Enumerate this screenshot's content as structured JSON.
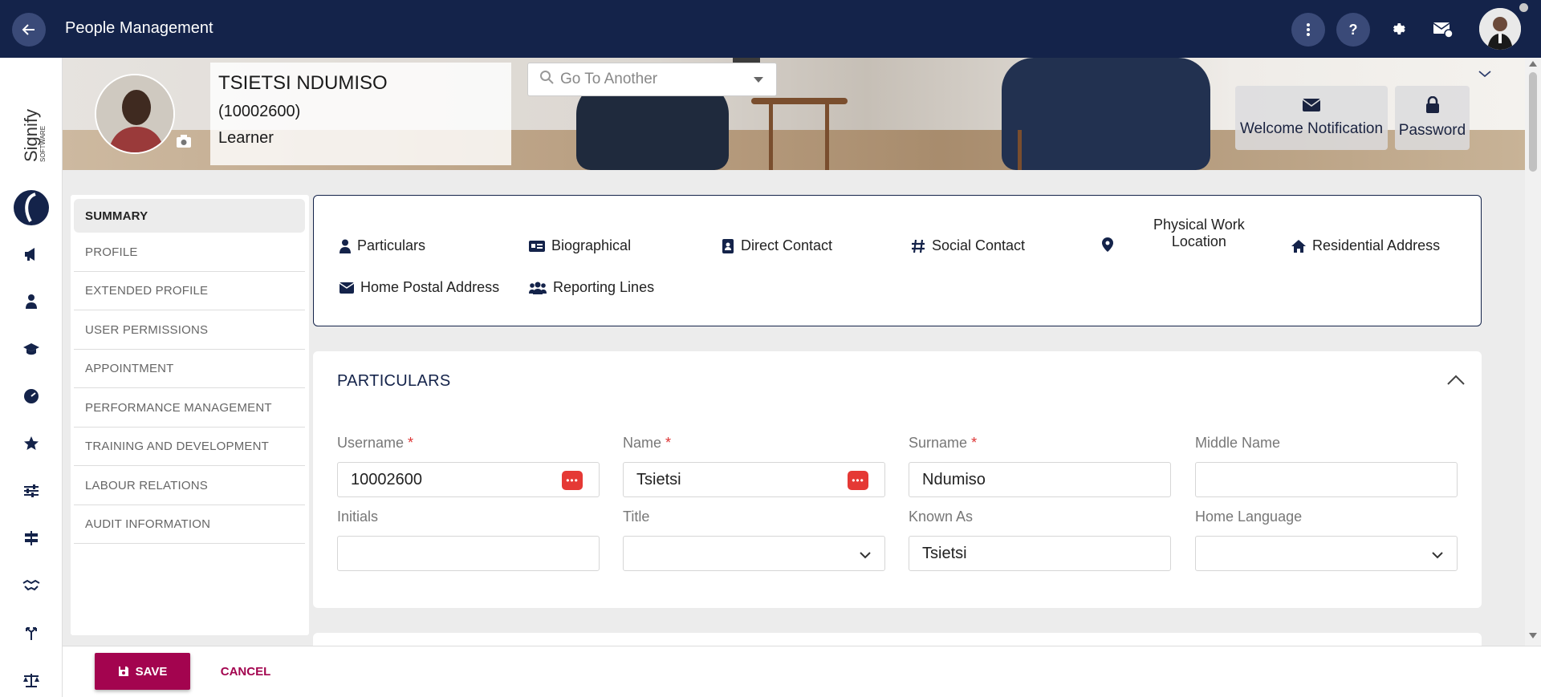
{
  "app": {
    "title": "People Management"
  },
  "profile": {
    "name": "TSIETSI NDUMISO",
    "id": "(10002600)",
    "role": "Learner"
  },
  "goto": {
    "placeholder": "Go To Another"
  },
  "banner_buttons": {
    "welcome": "Welcome Notification",
    "password": "Password"
  },
  "logo": {
    "brand": "Signify",
    "sub": "SOFTWARE"
  },
  "sidenav": {
    "items": [
      "SUMMARY",
      "PROFILE",
      "EXTENDED PROFILE",
      "USER PERMISSIONS",
      "APPOINTMENT",
      "PERFORMANCE MANAGEMENT",
      "TRAINING AND DEVELOPMENT",
      "LABOUR RELATIONS",
      "AUDIT INFORMATION"
    ]
  },
  "quick_links": {
    "particulars": "Particulars",
    "biographical": "Biographical",
    "direct_contact": "Direct Contact",
    "social_contact": "Social Contact",
    "physical_work_1": "Physical Work",
    "physical_work_2": "Location",
    "residential": "Residential Address",
    "home_postal": "Home Postal Address",
    "reporting_lines": "Reporting Lines"
  },
  "particulars": {
    "header": "PARTICULARS",
    "fields": {
      "username": {
        "label": "Username",
        "value": "10002600"
      },
      "name": {
        "label": "Name",
        "value": "Tsietsi"
      },
      "surname": {
        "label": "Surname",
        "value": "Ndumiso"
      },
      "middle_name": {
        "label": "Middle Name",
        "value": ""
      },
      "initials": {
        "label": "Initials",
        "value": ""
      },
      "title": {
        "label": "Title",
        "value": ""
      },
      "known_as": {
        "label": "Known As",
        "value": "Tsietsi"
      },
      "home_language": {
        "label": "Home Language",
        "value": ""
      }
    },
    "required_mark": "*"
  },
  "actions": {
    "save": "SAVE",
    "cancel": "CANCEL"
  },
  "colors": {
    "navy": "#14234a",
    "accent": "#a3044f",
    "required": "#dd3333"
  }
}
